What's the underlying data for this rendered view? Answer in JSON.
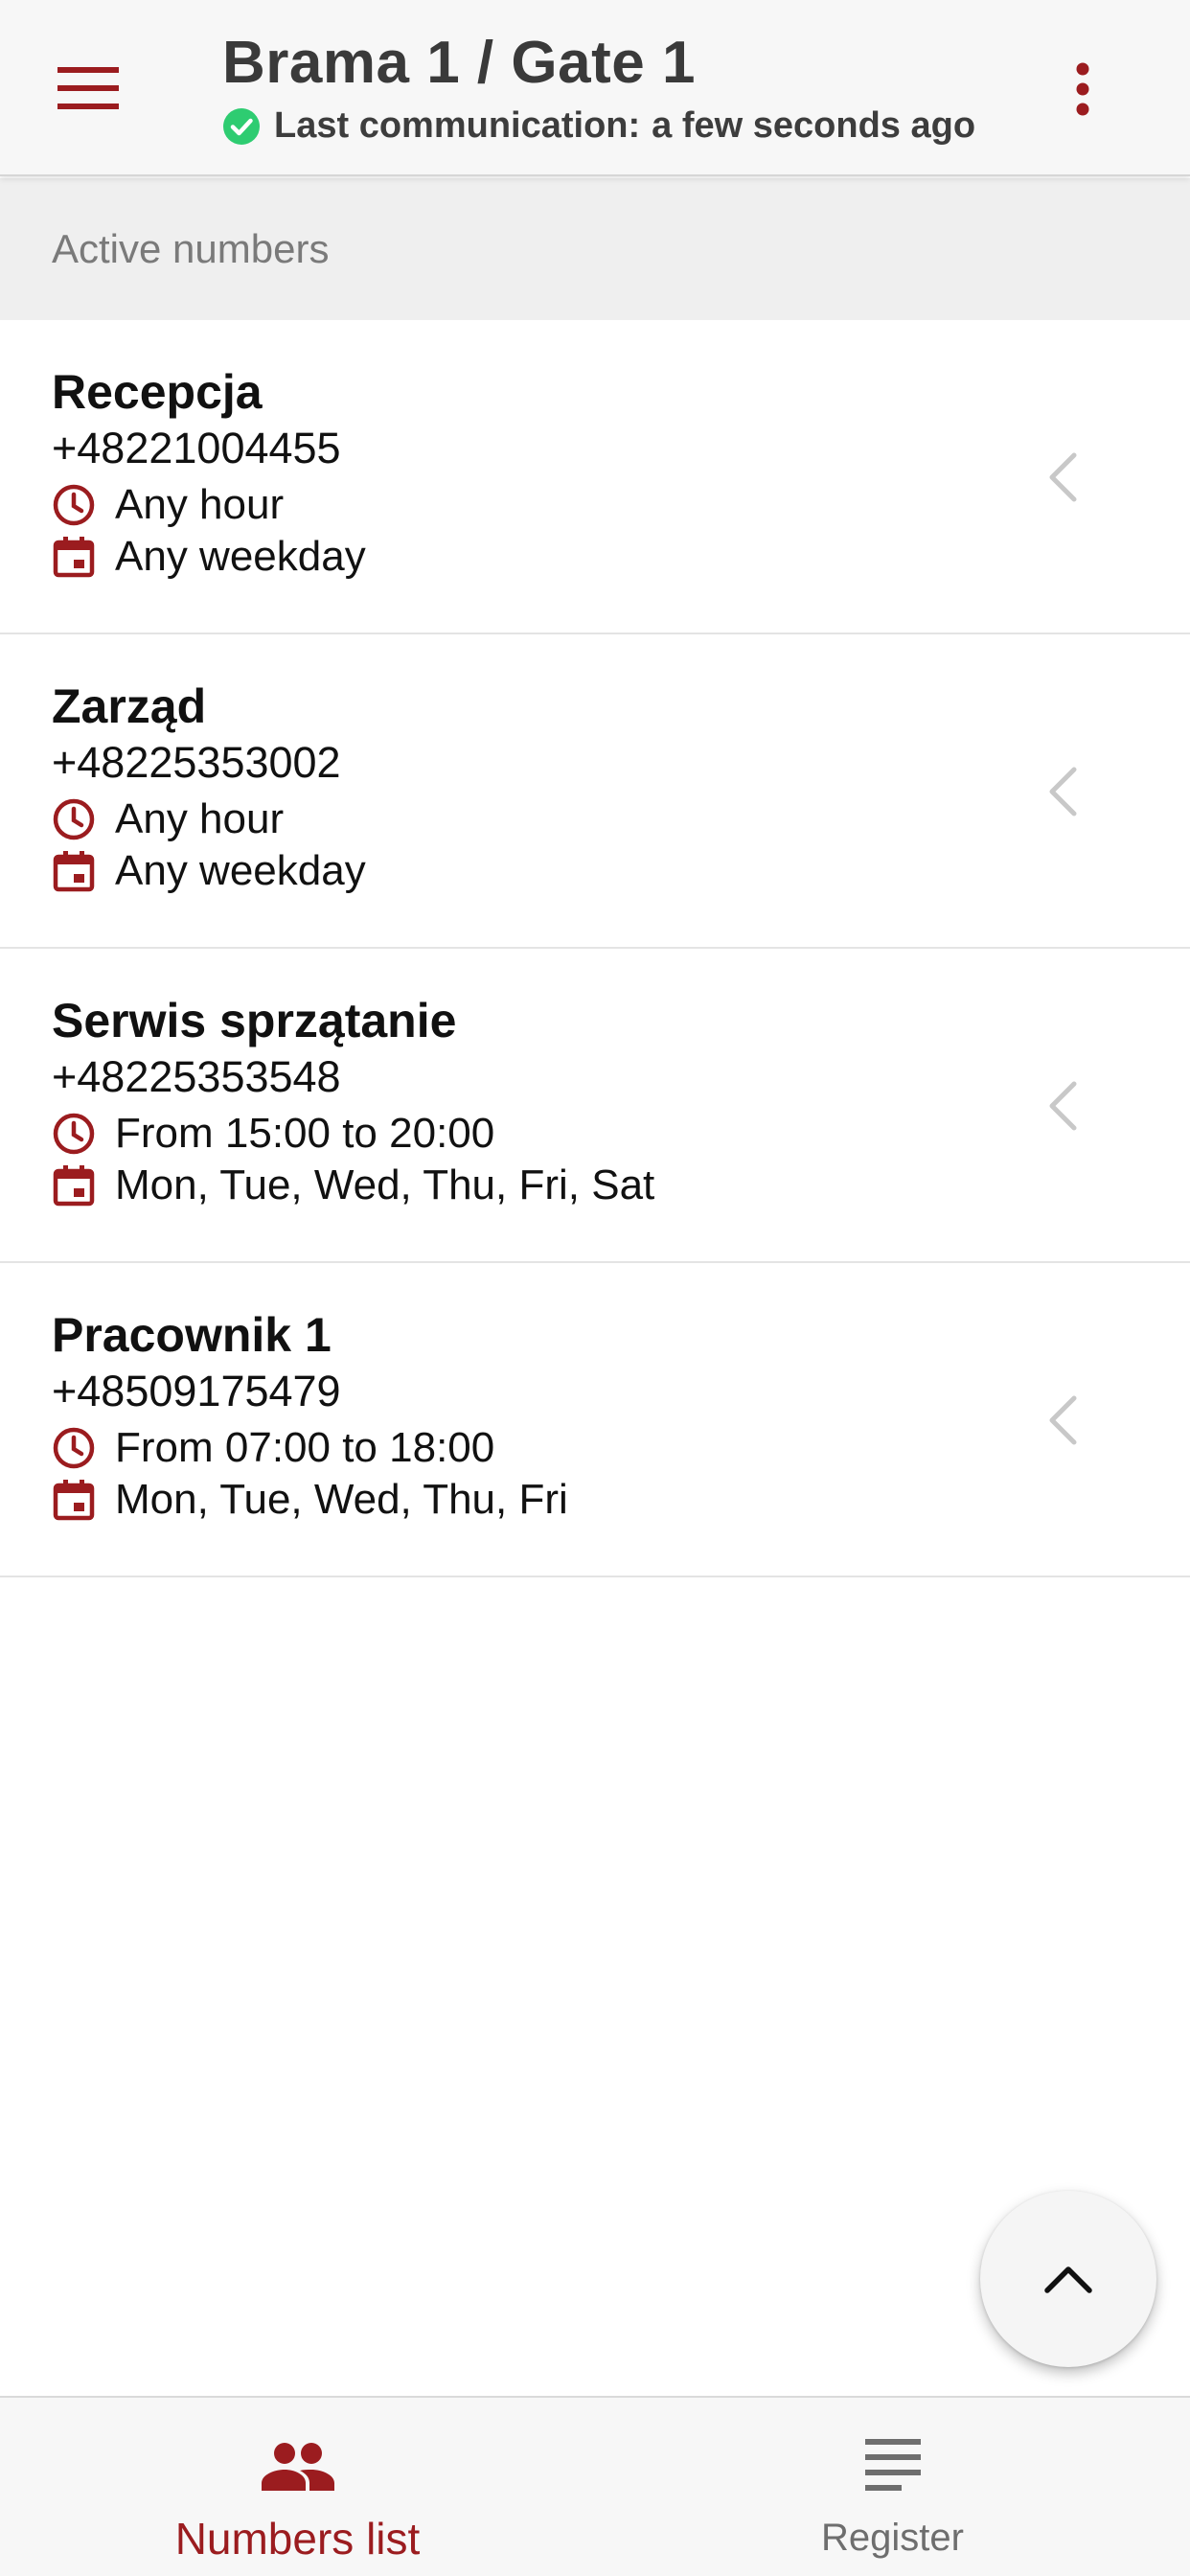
{
  "header": {
    "title": "Brama 1 / Gate 1",
    "status_label": "Last communication:",
    "status_value": "a few seconds ago",
    "menu_icon": "hamburger-menu-icon",
    "more_icon": "more-vert-icon",
    "status_icon": "check-circle-icon"
  },
  "section": {
    "title": "Active numbers"
  },
  "numbers": [
    {
      "name": "Recepcja",
      "phone": "+48221004455",
      "hours": "Any hour",
      "days": "Any weekday"
    },
    {
      "name": "Zarząd",
      "phone": "+48225353002",
      "hours": "Any hour",
      "days": "Any weekday"
    },
    {
      "name": "Serwis sprzątanie",
      "phone": "+48225353548",
      "hours": "From 15:00 to 20:00",
      "days": "Mon, Tue, Wed, Thu, Fri, Sat"
    },
    {
      "name": "Pracownik 1",
      "phone": "+48509175479",
      "hours": "From 07:00 to 18:00",
      "days": "Mon, Tue, Wed, Thu, Fri"
    }
  ],
  "bottom_nav": {
    "items": [
      {
        "label": "Numbers list",
        "icon": "people-icon",
        "active": true
      },
      {
        "label": "Register",
        "icon": "list-lines-icon",
        "active": false
      }
    ]
  },
  "colors": {
    "accent": "#9b1c1f",
    "success": "#2ecc71",
    "chevron": "#c8c8c8"
  }
}
